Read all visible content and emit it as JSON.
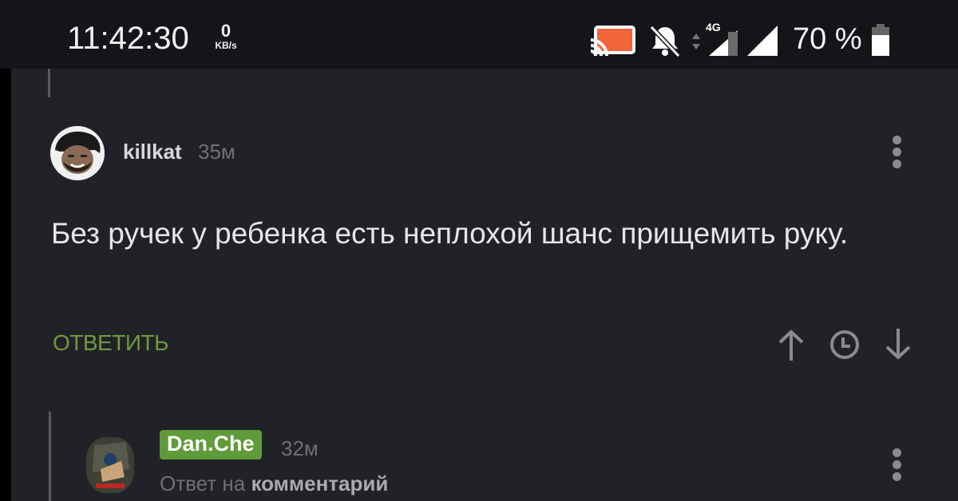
{
  "status_bar": {
    "time": "11:42:30",
    "net_speed_value": "0",
    "net_speed_unit": "KB/s",
    "icons": [
      "cast-icon",
      "bell-off-icon",
      "data-arrows-icon",
      "signal-4g-icon",
      "signal-icon",
      "battery-icon"
    ],
    "network_type": "4G",
    "battery_percent": "70 %",
    "cast_color": "#f2643a"
  },
  "comment": {
    "author": "killkat",
    "time_ago": "35м",
    "text": "Без ручек у ребенка есть неплохой шанс прищемить руку.",
    "reply_label": "ОТВЕТИТЬ",
    "accent_color": "#6f9a3d",
    "actions": [
      "upvote-arrow-icon",
      "clock-icon",
      "downvote-arrow-icon"
    ]
  },
  "reply": {
    "author": "Dan.Che",
    "time_ago": "32м",
    "reply_to_prefix": "Ответ на",
    "reply_to_link": "комментарий",
    "badge_color": "#5f9b3a"
  }
}
